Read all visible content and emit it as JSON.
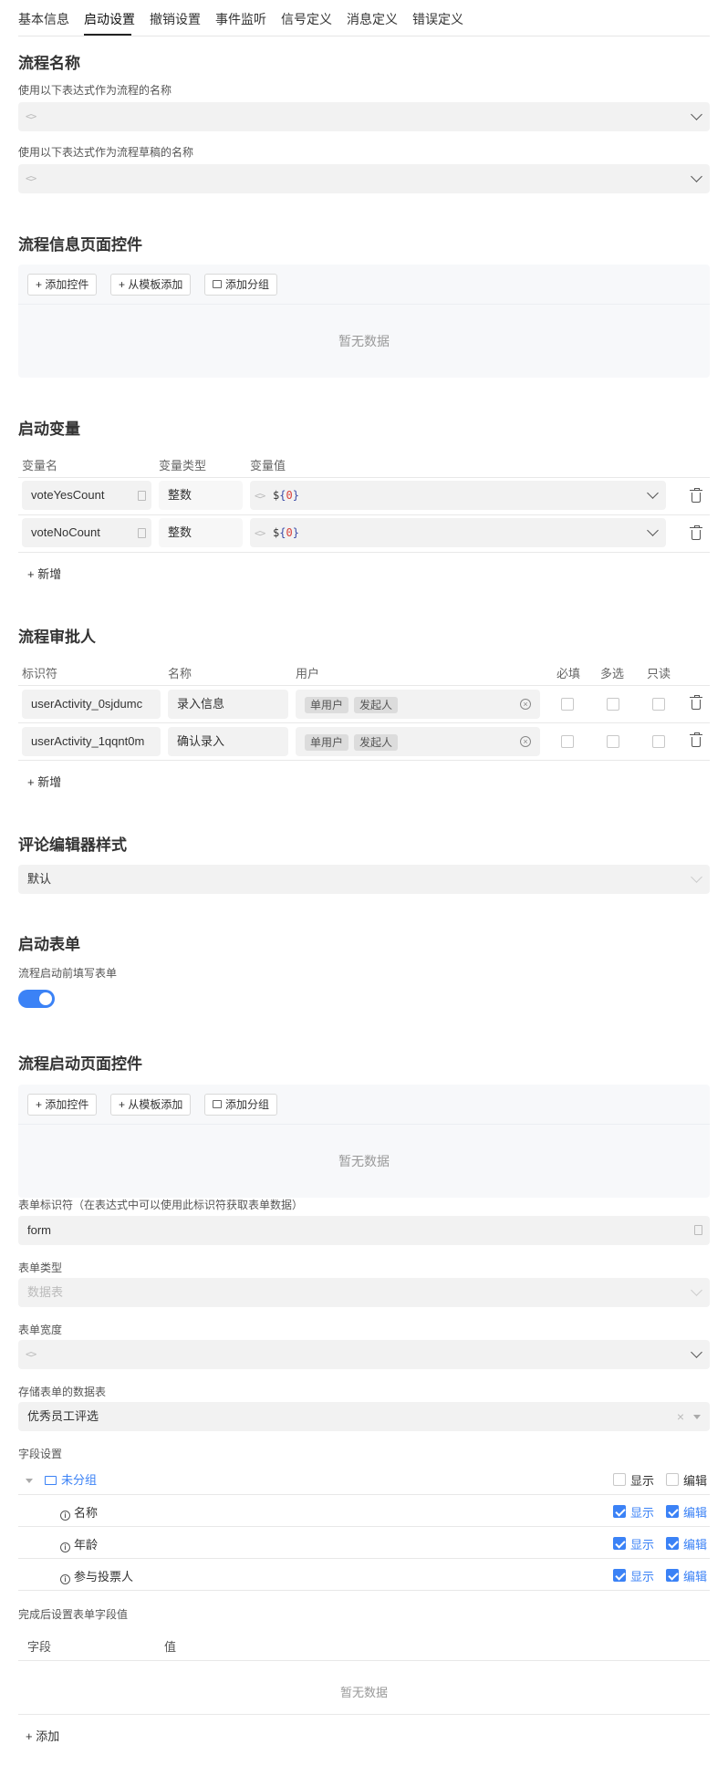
{
  "tabs": [
    "基本信息",
    "启动设置",
    "撤销设置",
    "事件监听",
    "信号定义",
    "消息定义",
    "错误定义"
  ],
  "active_tab": "启动设置",
  "process_name": {
    "title": "流程名称",
    "name_expr_label": "使用以下表达式作为流程的名称",
    "draft_expr_label": "使用以下表达式作为流程草稿的名称",
    "code_icon": "<>"
  },
  "info_controls": {
    "title": "流程信息页面控件",
    "add_control": "+ 添加控件",
    "add_from_template": "+ 从模板添加",
    "add_group": "添加分组",
    "empty": "暂无数据"
  },
  "start_vars": {
    "title": "启动变量",
    "headers": {
      "name": "变量名",
      "type": "变量类型",
      "value": "变量值"
    },
    "rows": [
      {
        "name": "voteYesCount",
        "type": "整数",
        "value_prefix": "$",
        "value_open": "{",
        "value_num": "0",
        "value_close": "}"
      },
      {
        "name": "voteNoCount",
        "type": "整数",
        "value_prefix": "$",
        "value_open": "{",
        "value_num": "0",
        "value_close": "}"
      }
    ],
    "add": "+ 新增"
  },
  "approvers": {
    "title": "流程审批人",
    "headers": {
      "id": "标识符",
      "name": "名称",
      "user": "用户",
      "required": "必填",
      "multi": "多选",
      "readonly": "只读"
    },
    "rows": [
      {
        "id": "userActivity_0sjdumc",
        "name": "录入信息",
        "tags": [
          "单用户",
          "发起人"
        ]
      },
      {
        "id": "userActivity_1qqnt0m",
        "name": "确认录入",
        "tags": [
          "单用户",
          "发起人"
        ]
      }
    ],
    "add": "+ 新增"
  },
  "comment_editor": {
    "title": "评论编辑器样式",
    "value": "默认"
  },
  "start_form": {
    "title": "启动表单",
    "label": "流程启动前填写表单",
    "enabled": true
  },
  "start_controls": {
    "title": "流程启动页面控件",
    "add_control": "+ 添加控件",
    "add_from_template": "+ 从模板添加",
    "add_group": "添加分组",
    "empty": "暂无数据"
  },
  "form_settings": {
    "id_label": "表单标识符（在表达式中可以使用此标识符获取表单数据）",
    "id_value": "form",
    "type_label": "表单类型",
    "type_placeholder": "数据表",
    "width_label": "表单宽度",
    "table_label": "存储表单的数据表",
    "table_value": "优秀员工评选",
    "fields_label": "字段设置",
    "group_name": "未分组",
    "show": "显示",
    "edit": "编辑",
    "fields": [
      "名称",
      "年龄",
      "参与投票人"
    ],
    "after_label": "完成后设置表单字段值",
    "after_headers": {
      "field": "字段",
      "value": "值"
    },
    "after_empty": "暂无数据",
    "add": "+ 添加"
  }
}
